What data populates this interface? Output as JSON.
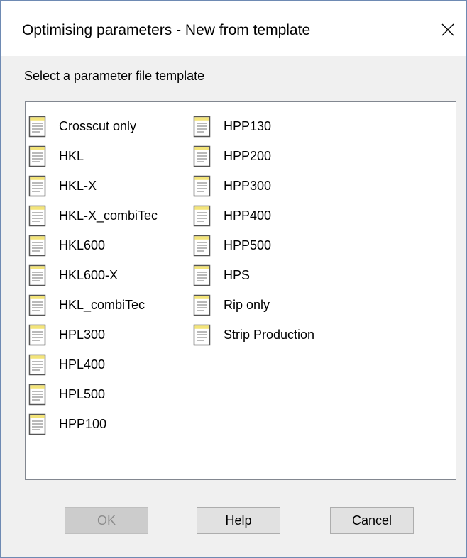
{
  "window": {
    "title": "Optimising parameters - New from template"
  },
  "prompt": "Select a parameter file template",
  "templates": {
    "column1": [
      "Crosscut only",
      "HKL",
      "HKL-X",
      "HKL-X_combiTec",
      "HKL600",
      "HKL600-X",
      "HKL_combiTec",
      "HPL300",
      "HPL400",
      "HPL500",
      "HPP100"
    ],
    "column2": [
      "HPP130",
      "HPP200",
      "HPP300",
      "HPP400",
      "HPP500",
      "HPS",
      "Rip only",
      "Strip Production"
    ]
  },
  "buttons": {
    "ok": "OK",
    "ok_enabled": false,
    "help": "Help",
    "cancel": "Cancel"
  },
  "icons": {
    "close": "close-icon",
    "item": "document-icon"
  }
}
